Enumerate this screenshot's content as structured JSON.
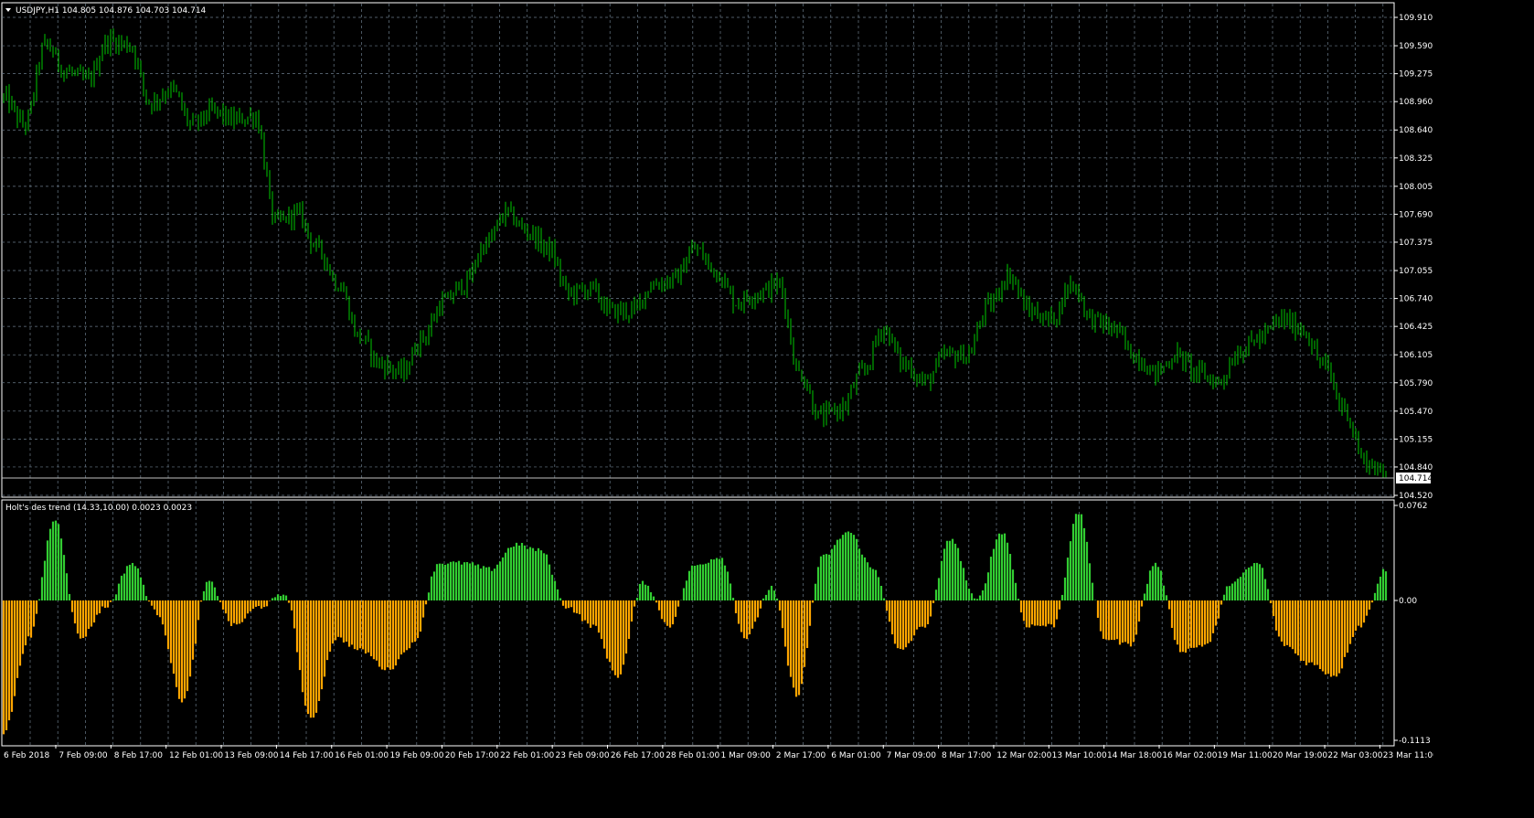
{
  "main_chart": {
    "symbol_header": "USDJPY,H1  104.805 104.876 104.703 104.714",
    "current_price_label": "104.714",
    "price_axis_labels": [
      "109.910",
      "109.590",
      "109.275",
      "108.960",
      "108.640",
      "108.325",
      "108.005",
      "107.690",
      "107.375",
      "107.055",
      "106.740",
      "106.425",
      "106.105",
      "105.790",
      "105.470",
      "105.155",
      "104.840",
      "104.520"
    ],
    "candle_color": "#00c800",
    "background": "#000000",
    "grid_color": "#6b7b8a"
  },
  "indicator": {
    "title": "Holt's des trend (14.33,10.00) 0.0023 0.0023",
    "axis_labels": [
      "0.0762",
      "0.00",
      "-0.1113"
    ],
    "positive_color": "#32cd32",
    "negative_color": "#ffa500"
  },
  "time_axis_labels": [
    "6 Feb 2018",
    "7 Feb 09:00",
    "8 Feb 17:00",
    "12 Feb 01:00",
    "13 Feb 09:00",
    "14 Feb 17:00",
    "16 Feb 01:00",
    "19 Feb 09:00",
    "20 Feb 17:00",
    "22 Feb 01:00",
    "23 Feb 09:00",
    "26 Feb 17:00",
    "28 Feb 01:00",
    "1 Mar 09:00",
    "2 Mar 17:00",
    "6 Mar 01:00",
    "7 Mar 09:00",
    "8 Mar 17:00",
    "12 Mar 02:00",
    "13 Mar 10:00",
    "14 Mar 18:00",
    "16 Mar 02:00",
    "19 Mar 11:00",
    "20 Mar 19:00",
    "22 Mar 03:00",
    "23 Mar 11:00"
  ],
  "chart_data": {
    "type": "line",
    "title": "USDJPY,H1",
    "ylim": [
      104.52,
      110.0
    ],
    "series": [
      {
        "name": "USDJPY,H1",
        "anchors": [
          109.0,
          108.7,
          109.6,
          109.3,
          109.2,
          109.65,
          109.6,
          108.95,
          109.1,
          108.7,
          108.85,
          108.75,
          108.8,
          107.6,
          107.7,
          107.3,
          106.9,
          106.3,
          106.0,
          105.9,
          106.3,
          106.7,
          106.9,
          107.35,
          107.7,
          107.5,
          107.3,
          106.8,
          106.85,
          106.6,
          106.6,
          106.9,
          106.95,
          107.3,
          107.05,
          106.7,
          106.8,
          106.9,
          105.9,
          105.4,
          105.5,
          105.9,
          106.4,
          106.0,
          105.8,
          106.1,
          106.1,
          106.65,
          107.0,
          106.6,
          106.5,
          106.9,
          106.5,
          106.4,
          106.1,
          105.9,
          106.1,
          105.9,
          105.8,
          106.15,
          106.3,
          106.5,
          106.4,
          106.0,
          105.5,
          104.9,
          104.75
        ]
      },
      {
        "name": "Holt's des trend (14.33,10.00)",
        "anchors": [
          -0.105,
          -0.03,
          0.065,
          -0.03,
          -0.005,
          0.03,
          -0.01,
          -0.08,
          0.015,
          -0.02,
          -0.005,
          0.005,
          -0.095,
          -0.03,
          -0.04,
          -0.055,
          -0.035,
          0.03,
          0.03,
          0.025,
          0.045,
          0.04,
          -0.005,
          -0.02,
          -0.06,
          0.015,
          -0.02,
          0.028,
          0.035,
          -0.03,
          0.01,
          -0.075,
          0.035,
          0.055,
          0.025,
          -0.04,
          -0.02,
          0.05,
          0.0,
          0.055,
          -0.02,
          -0.02,
          0.07,
          -0.03,
          -0.035,
          0.03,
          -0.04,
          -0.035,
          0.015,
          0.03,
          -0.035,
          -0.05,
          -0.06,
          -0.02,
          0.025
        ]
      }
    ]
  }
}
